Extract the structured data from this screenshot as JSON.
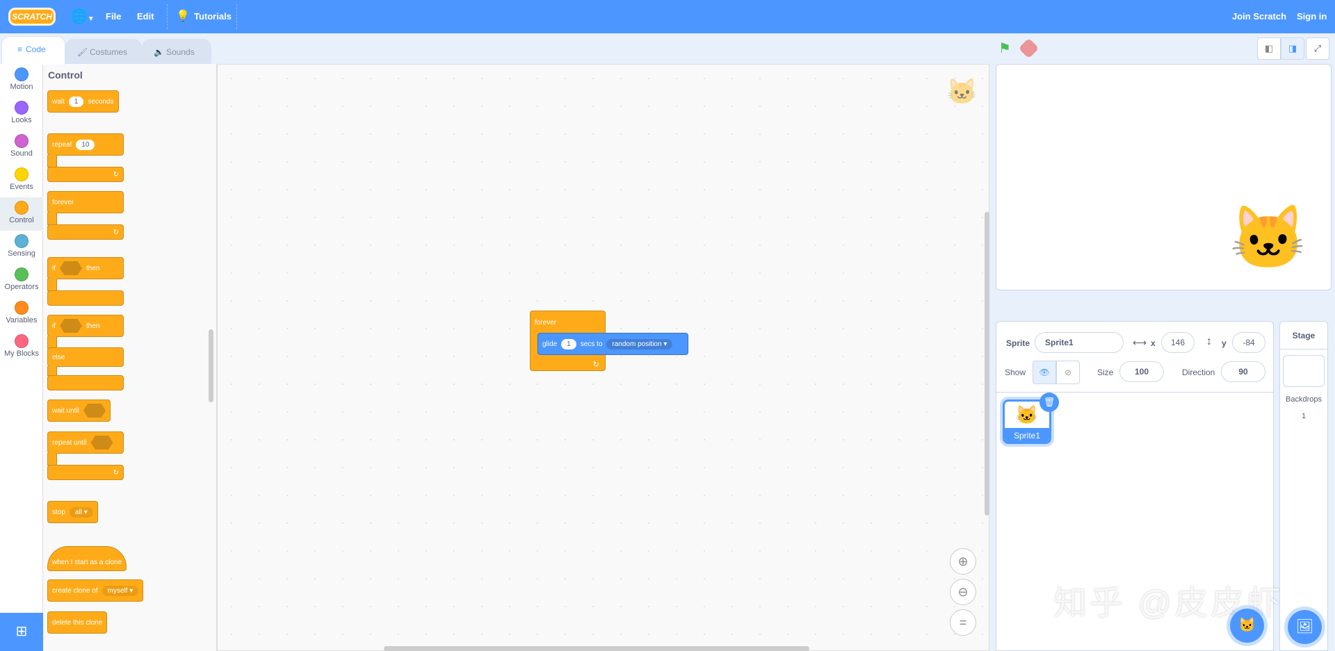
{
  "menubar": {
    "logo": "SCRATCH",
    "file": "File",
    "edit": "Edit",
    "tutorials": "Tutorials",
    "join": "Join Scratch",
    "signin": "Sign in"
  },
  "tabs": [
    {
      "label": "Code"
    },
    {
      "label": "Costumes"
    },
    {
      "label": "Sounds"
    }
  ],
  "categories": [
    {
      "label": "Motion",
      "color": "#4c97ff"
    },
    {
      "label": "Looks",
      "color": "#9966ff"
    },
    {
      "label": "Sound",
      "color": "#cf63cf"
    },
    {
      "label": "Events",
      "color": "#ffd500"
    },
    {
      "label": "Control",
      "color": "#ffab19"
    },
    {
      "label": "Sensing",
      "color": "#5cb1d6"
    },
    {
      "label": "Operators",
      "color": "#59c059"
    },
    {
      "label": "Variables",
      "color": "#ff8c1a"
    },
    {
      "label": "My Blocks",
      "color": "#ff6680"
    }
  ],
  "palette": {
    "heading": "Control",
    "wait": {
      "a": "wait",
      "v": "1",
      "b": "seconds"
    },
    "repeat": {
      "a": "repeat",
      "v": "10"
    },
    "forever": "forever",
    "if_then": {
      "a": "if",
      "b": "then"
    },
    "if_else": {
      "a": "if",
      "b": "then",
      "c": "else"
    },
    "wait_until": "wait until",
    "repeat_until": "repeat until",
    "stop": {
      "a": "stop",
      "v": "all"
    },
    "clone_start": "when I start as a clone",
    "create_clone": {
      "a": "create clone of",
      "v": "myself"
    },
    "delete_clone": "delete this clone"
  },
  "script": {
    "forever": "forever",
    "glide": "glide",
    "glide_secs": "1",
    "secs_to": "secs to",
    "target": "random position"
  },
  "colors": {
    "accent": "#4c97ff",
    "control": "#ffab19",
    "motion": "#4c97ff"
  },
  "sprite": {
    "label": "Sprite",
    "name": "Sprite1",
    "x_label": "x",
    "x": "146",
    "y_label": "y",
    "y": "-84",
    "show_label": "Show",
    "size_label": "Size",
    "size": "100",
    "direction_label": "Direction",
    "direction": "90"
  },
  "sprites": [
    {
      "name": "Sprite1"
    }
  ],
  "stage_panel": {
    "title": "Stage",
    "backdrops_label": "Backdrops",
    "backdrops_count": "1"
  },
  "watermark": "知乎 @皮皮虾"
}
